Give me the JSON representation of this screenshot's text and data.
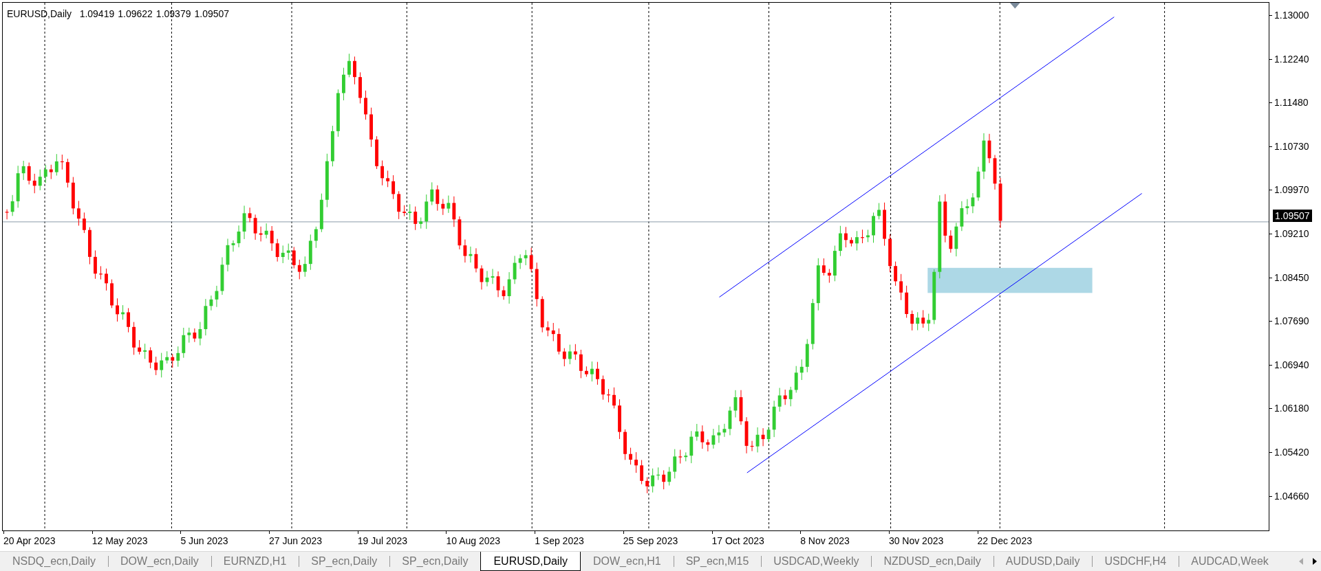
{
  "chart_header": {
    "symbol": "EURUSD,Daily",
    "ohlc": [
      "1.09419",
      "1.09622",
      "1.09379",
      "1.09507"
    ]
  },
  "price_axis": {
    "labels": [
      "1.13000",
      "1.12240",
      "1.11480",
      "1.10730",
      "1.09970",
      "1.09210",
      "1.08450",
      "1.07690",
      "1.06940",
      "1.06180",
      "1.05420",
      "1.04660"
    ],
    "current_price": "1.09507"
  },
  "time_axis": {
    "labels": [
      "20 Apr 2023",
      "12 May 2023",
      "5 Jun 2023",
      "27 Jun 2023",
      "19 Jul 2023",
      "10 Aug 2023",
      "1 Sep 2023",
      "25 Sep 2023",
      "17 Oct 2023",
      "8 Nov 2023",
      "30 Nov 2023",
      "22 Dec 2023"
    ]
  },
  "tabs": [
    {
      "label": "NSDQ_ecn,Daily",
      "selected": false
    },
    {
      "label": "DOW_ecn,Daily",
      "selected": false
    },
    {
      "label": "EURNZD,H1",
      "selected": false
    },
    {
      "label": "SP_ecn,Daily",
      "selected": false
    },
    {
      "label": "SP_ecn,Daily",
      "selected": false
    },
    {
      "label": "EURUSD,Daily",
      "selected": true
    },
    {
      "label": "DOW_ecn,H1",
      "selected": false
    },
    {
      "label": "SP_ecn,M15",
      "selected": false
    },
    {
      "label": "USDCAD,Weekly",
      "selected": false
    },
    {
      "label": "NZDUSD_ecn,Daily",
      "selected": false
    },
    {
      "label": "AUDUSD,Daily",
      "selected": false
    },
    {
      "label": "USDCHF,H4",
      "selected": false
    },
    {
      "label": "AUDCAD,Week",
      "selected": false
    }
  ]
}
